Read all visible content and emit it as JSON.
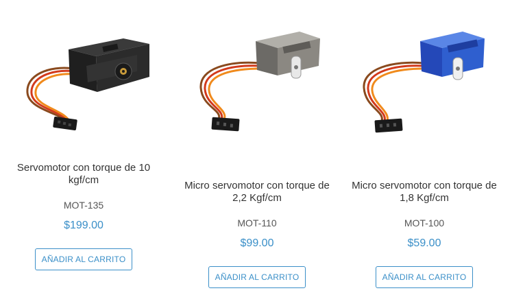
{
  "products": [
    {
      "title": "Servomotor con torque de 10 kgf/cm",
      "sku": "MOT-135",
      "price": "$199.00",
      "button_label": "AÑADIR AL CARRITO",
      "image_icon": "servo-motor-black",
      "body_color": "#2b2b2b"
    },
    {
      "title": "Micro servomotor con torque de 2,2 Kgf/cm",
      "sku": "MOT-110",
      "price": "$99.00",
      "button_label": "AÑADIR AL CARRITO",
      "image_icon": "micro-servo-translucent-gray",
      "body_color": "#7d7a74"
    },
    {
      "title": "Micro servomotor con torque de 1,8 Kgf/cm",
      "sku": "MOT-100",
      "price": "$59.00",
      "button_label": "AÑADIR AL CARRITO",
      "image_icon": "micro-servo-blue",
      "body_color": "#2f5fcf"
    }
  ],
  "colors": {
    "accent": "#3a8fc8",
    "text": "#333333"
  }
}
